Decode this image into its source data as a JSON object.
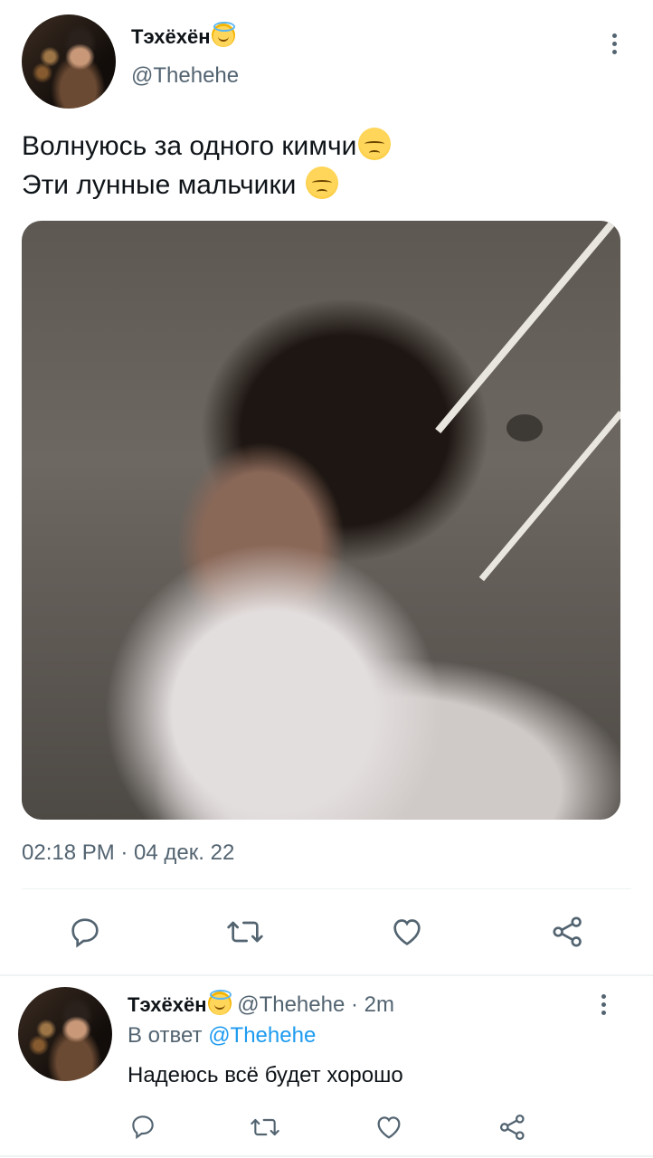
{
  "tweet": {
    "display_name": "Тэхёхён",
    "handle": "@Thehehe",
    "text_line1": "Волнуюсь за одного кимчи",
    "text_line2": "Эти лунные мальчики",
    "timestamp": "02:18 PM · 04 дек. 22",
    "name_emoji": "smiling-face-with-halo",
    "text_emoji": "pensive-face"
  },
  "reply": {
    "display_name": "Тэхёхён",
    "handle": "@Thehehe",
    "time": "· 2m",
    "reply_to_prefix": "В ответ",
    "reply_to_handle": "@Thehehe",
    "text": "Надеюсь всё будет хорошо"
  },
  "colors": {
    "text": "#0f1419",
    "secondary": "#536471",
    "link": "#1d9bf0",
    "divider": "#eff3f4"
  }
}
